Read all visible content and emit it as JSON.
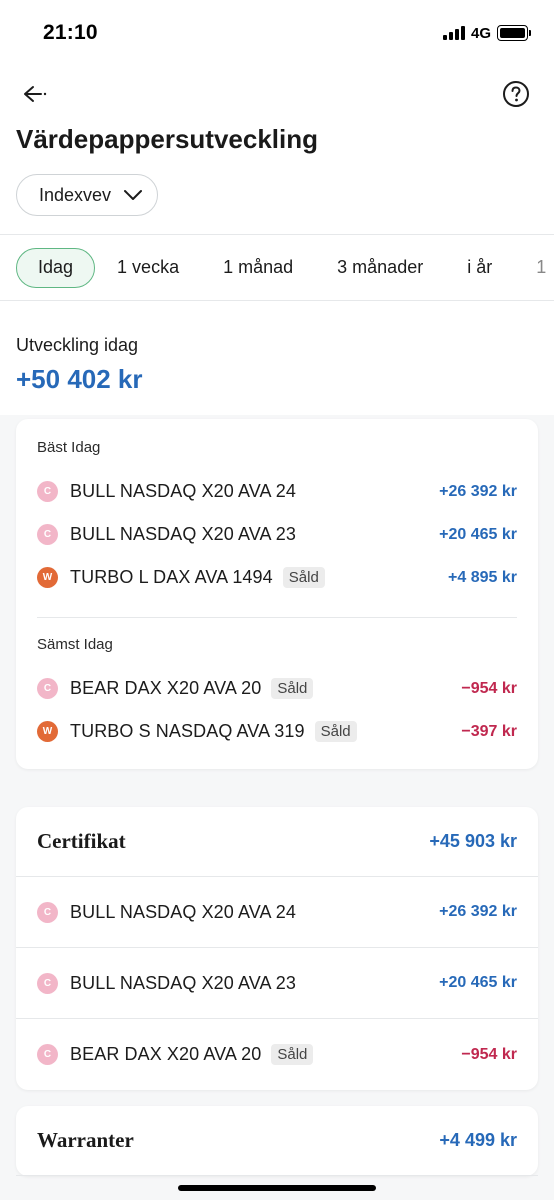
{
  "status": {
    "time": "21:10",
    "network": "4G"
  },
  "header": {
    "title": "Värdepappersutveckling"
  },
  "account": {
    "selected": "Indexvev"
  },
  "tabs": [
    {
      "label": "Idag",
      "active": true
    },
    {
      "label": "1 vecka",
      "active": false
    },
    {
      "label": "1 månad",
      "active": false
    },
    {
      "label": "3 månader",
      "active": false
    },
    {
      "label": "i år",
      "active": false
    },
    {
      "label": "1",
      "active": false
    }
  ],
  "summary": {
    "label": "Utveckling idag",
    "value": "+50 402 kr"
  },
  "best": {
    "label": "Bäst Idag",
    "items": [
      {
        "badge": "C",
        "name": "BULL NASDAQ X20 AVA 24",
        "sold": "",
        "amount": "+26 392 kr"
      },
      {
        "badge": "C",
        "name": "BULL NASDAQ X20 AVA 23",
        "sold": "",
        "amount": "+20 465 kr"
      },
      {
        "badge": "W",
        "name": "TURBO L DAX AVA 1494",
        "sold": "Såld",
        "amount": "+4 895 kr"
      }
    ]
  },
  "worst": {
    "label": "Sämst Idag",
    "items": [
      {
        "badge": "C",
        "name": "BEAR DAX X20 AVA 20",
        "sold": "Såld",
        "amount": "−954 kr"
      },
      {
        "badge": "W",
        "name": "TURBO S NASDAQ AVA 319",
        "sold": "Såld",
        "amount": "−397 kr"
      }
    ]
  },
  "certifikat": {
    "title": "Certifikat",
    "amount": "+45 903 kr",
    "items": [
      {
        "badge": "C",
        "name": "BULL NASDAQ X20 AVA 24",
        "sold": "",
        "amount": "+26 392 kr"
      },
      {
        "badge": "C",
        "name": "BULL NASDAQ X20 AVA 23",
        "sold": "",
        "amount": "+20 465 kr"
      },
      {
        "badge": "C",
        "name": "BEAR DAX X20 AVA 20",
        "sold": "Såld",
        "amount": "−954 kr"
      }
    ]
  },
  "warranter": {
    "title": "Warranter",
    "amount": "+4 499 kr"
  },
  "colors": {
    "positive": "#2769b8",
    "negative": "#c0284f",
    "accent": "#5fb783",
    "cert_badge": "#f2b6c8",
    "warrant_badge": "#e26a37"
  },
  "icons": {
    "back": "arrow-left-icon",
    "help": "question-circle-icon",
    "dropdown": "chevron-down-icon"
  }
}
